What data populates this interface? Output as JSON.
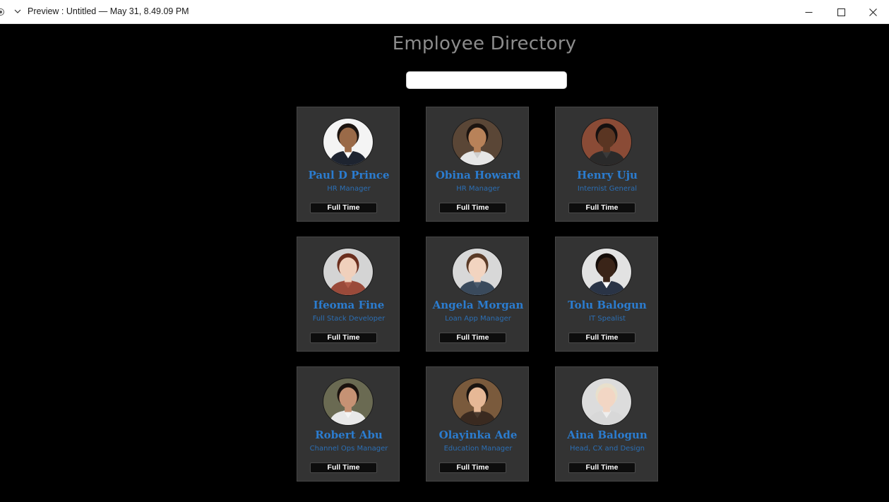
{
  "window": {
    "title": "Preview : Untitled — May 31, 8.49.09 PM"
  },
  "page": {
    "title": "Employee Directory",
    "search": {
      "value": "",
      "placeholder": ""
    }
  },
  "employees": [
    {
      "name": "Paul D Prince",
      "role": "HR Manager",
      "status": "Full Time",
      "avatar": {
        "bg": "#f4f4f4",
        "skin": "#9a6a48",
        "hair": "#1c1410",
        "shirt": "#1e2430",
        "collar": "#ffffff"
      }
    },
    {
      "name": "Obina Howard",
      "role": "HR Manager",
      "status": "Full Time",
      "avatar": {
        "bg": "#5a4636",
        "skin": "#b88259",
        "hair": "#1c1410",
        "shirt": "#e6e6e6",
        "collar": "#cfcfcf"
      }
    },
    {
      "name": "Henry Uju",
      "role": "Internist General",
      "status": "Full Time",
      "avatar": {
        "bg": "#8a4b36",
        "skin": "#5a3522",
        "hair": "#141010",
        "shirt": "#2a2a2a",
        "collar": "#3a3a3a"
      }
    },
    {
      "name": "Ifeoma Fine",
      "role": "Full Stack Developer",
      "status": "Full Time",
      "avatar": {
        "bg": "#d4d4d4",
        "skin": "#f0d0bc",
        "hair": "#6a2e1e",
        "shirt": "#9a4a3a",
        "collar": "#b05a48"
      }
    },
    {
      "name": "Angela Morgan",
      "role": "Loan App Manager",
      "status": "Full Time",
      "avatar": {
        "bg": "#d8d8d8",
        "skin": "#f2d4c0",
        "hair": "#5a3a26",
        "shirt": "#3a4a5c",
        "collar": "#4a5a6c"
      }
    },
    {
      "name": "Tolu Balogun",
      "role": "IT Spealist",
      "status": "Full Time",
      "avatar": {
        "bg": "#e2e2e2",
        "skin": "#3a2418",
        "hair": "#140c08",
        "shirt": "#2a3446",
        "collar": "#ffffff"
      }
    },
    {
      "name": "Robert Abu",
      "role": "Channel Ops Manager",
      "status": "Full Time",
      "avatar": {
        "bg": "#6a6a52",
        "skin": "#c69274",
        "hair": "#1a120e",
        "shirt": "#e8e8e8",
        "collar": "#f4f4f4"
      }
    },
    {
      "name": "Olayinka Ade",
      "role": "Education Manager",
      "status": "Full Time",
      "avatar": {
        "bg": "#7a5a3c",
        "skin": "#e6b896",
        "hair": "#1a1410",
        "shirt": "#3a2a20",
        "collar": "#4a3a2e"
      }
    },
    {
      "name": "Aina Balogun",
      "role": "Head, CX and Design",
      "status": "Full Time",
      "avatar": {
        "bg": "#dcdcdc",
        "skin": "#f2d6c4",
        "hair": "#e8e0cc",
        "shirt": "#d8d8d8",
        "collar": "#eeeeee"
      }
    }
  ]
}
